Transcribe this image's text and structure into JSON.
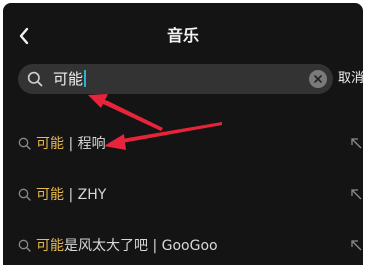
{
  "header": {
    "title": "音乐"
  },
  "search": {
    "value": "可能",
    "cancel_label": "取消"
  },
  "suggestions": [
    {
      "highlight": "可能",
      "rest": " | 程响"
    },
    {
      "highlight": "可能",
      "rest": " | ZHY"
    },
    {
      "highlight": "可能",
      "rest": "是风太大了吧 | GooGoo"
    }
  ],
  "colors": {
    "background": "#141414",
    "highlight": "#e9b94a",
    "caret": "#2bb3c8",
    "annotation_arrow": "#e8243a"
  },
  "icons": {
    "back": "chevron-left-icon",
    "search": "search-icon",
    "clear": "clear-circle-icon",
    "fill_query": "arrow-up-left-icon"
  }
}
